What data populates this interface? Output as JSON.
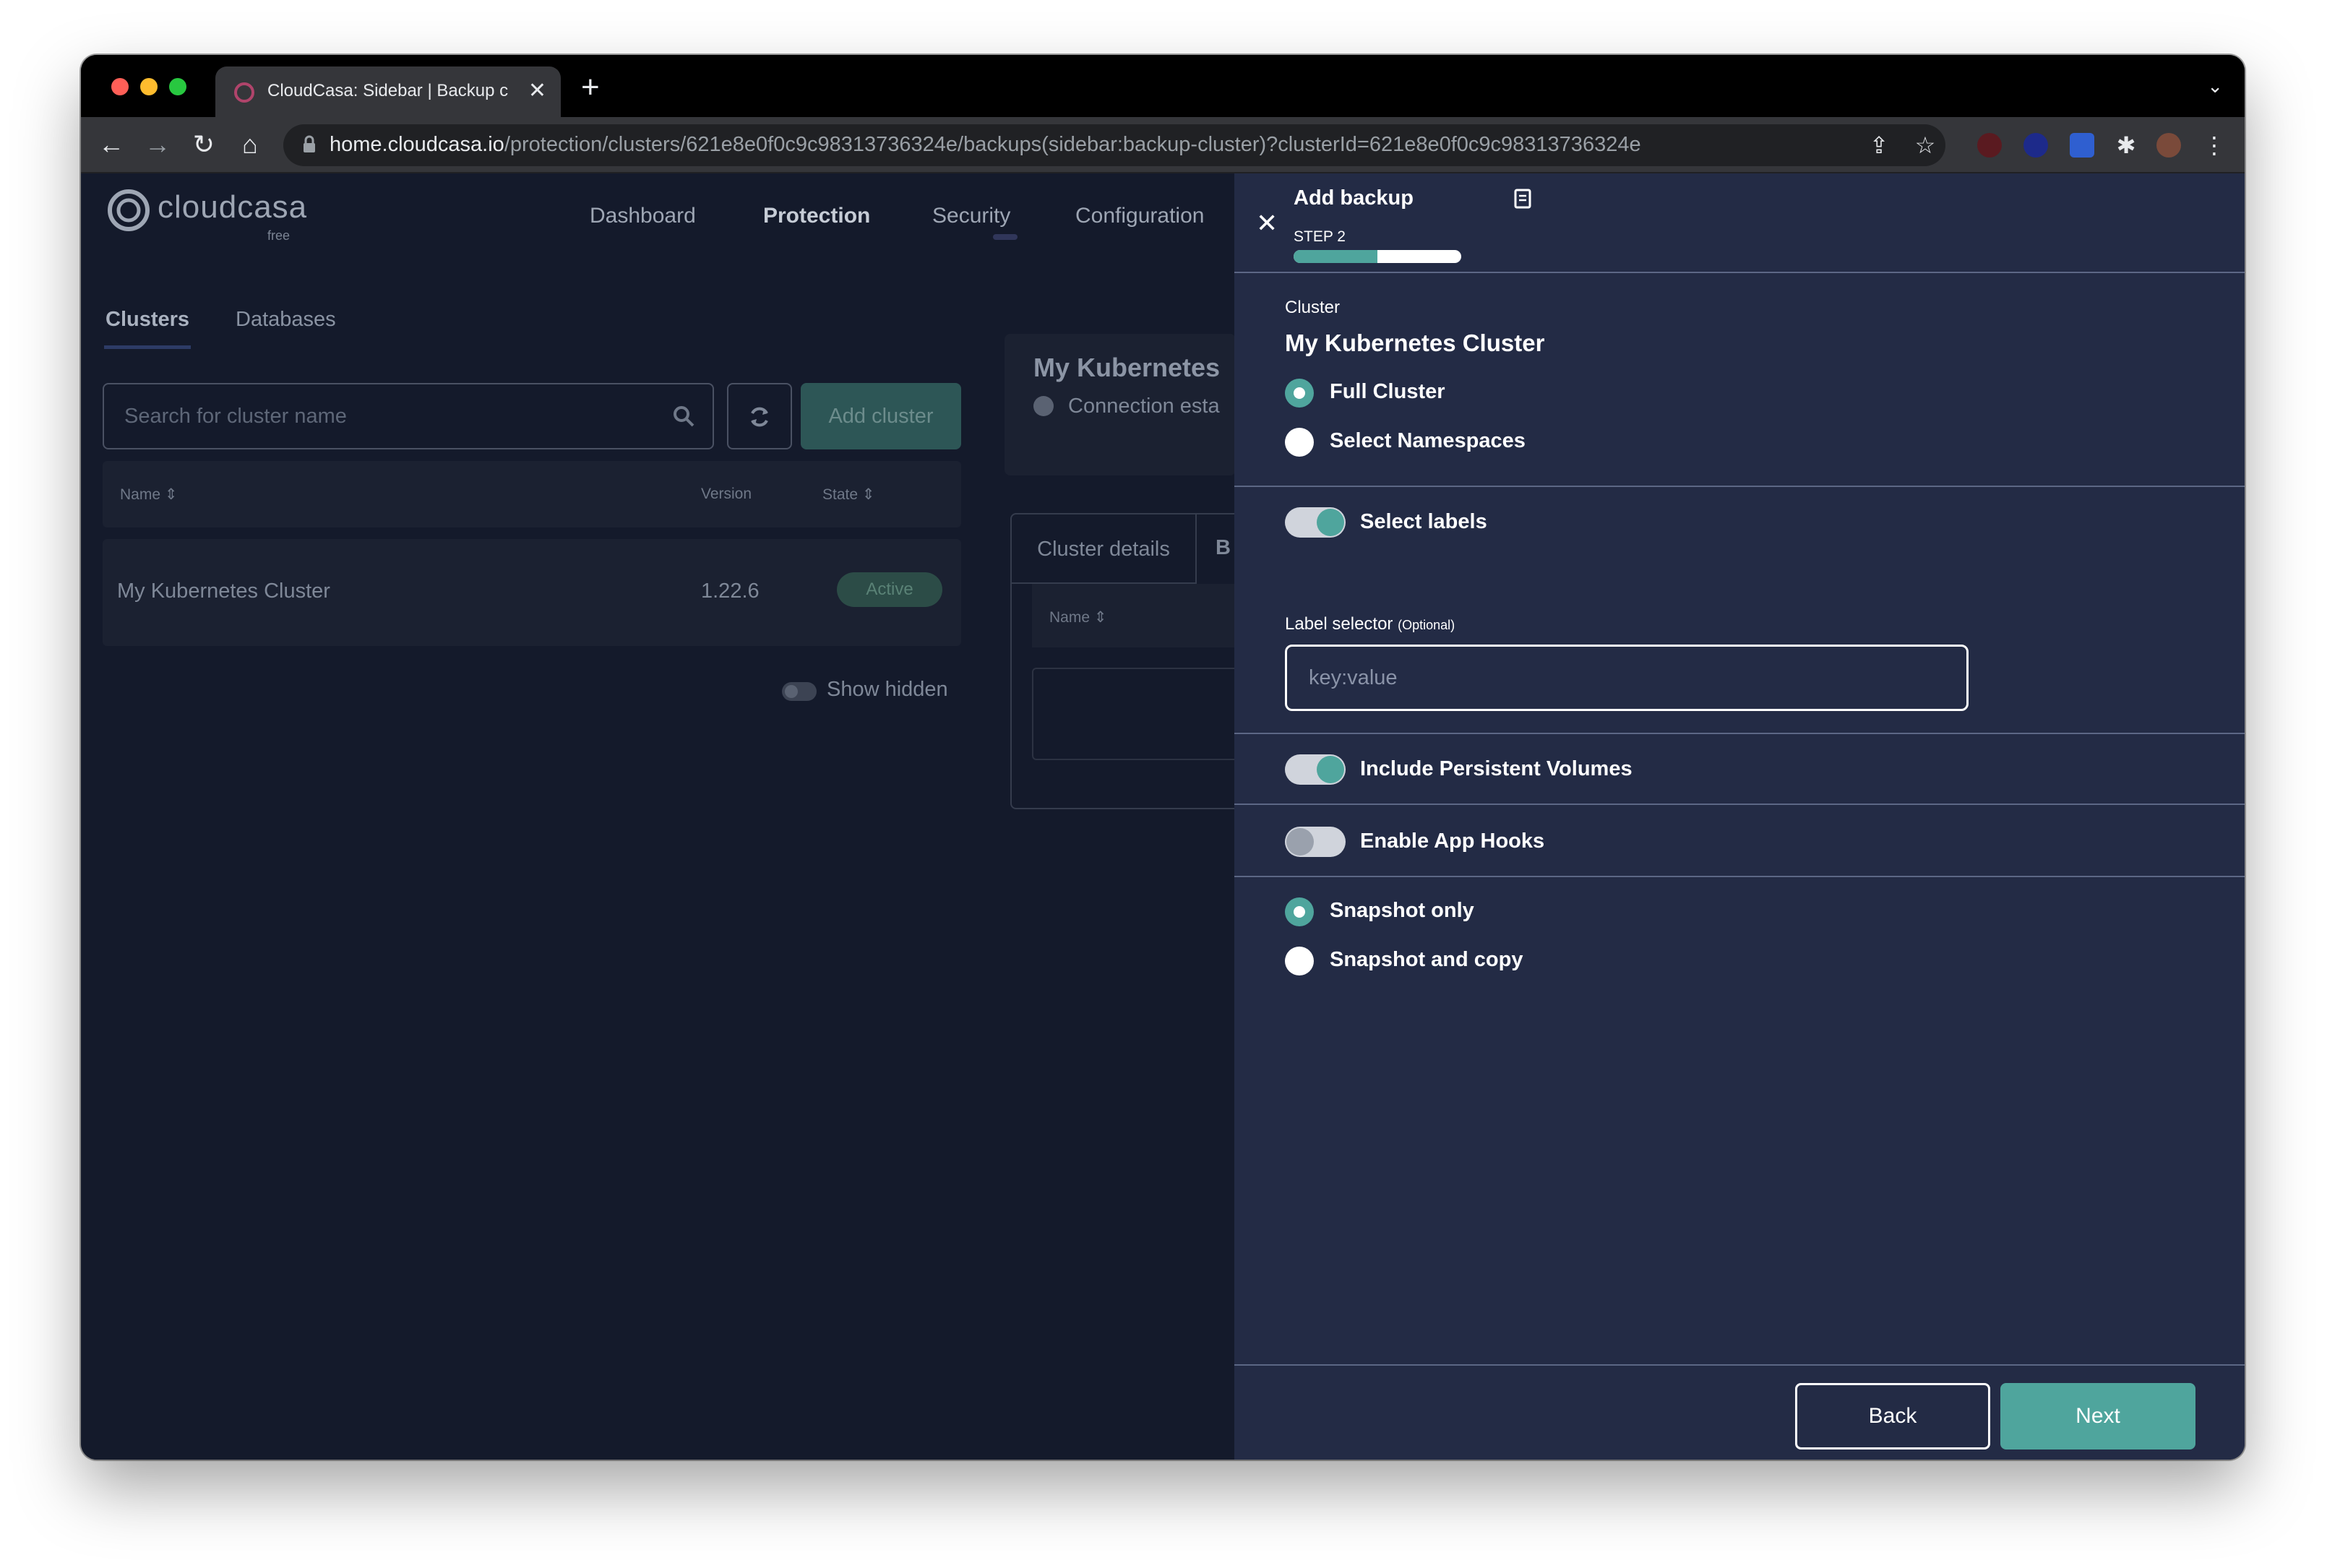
{
  "browser": {
    "tab_title": "CloudCasa: Sidebar | Backup c",
    "url_host": "home.cloudcasa.io",
    "url_path": "/protection/clusters/621e8e0f0c9c98313736324e/backups(sidebar:backup-cluster)?clusterId=621e8e0f0c9c98313736324e"
  },
  "app": {
    "logo": "cloudcasa",
    "logo_sub": "free",
    "nav": [
      "Dashboard",
      "Protection",
      "Security",
      "Configuration"
    ],
    "left_tabs": [
      "Clusters",
      "Databases"
    ],
    "search_placeholder": "Search for cluster name",
    "add_cluster": "Add cluster",
    "table_headers": {
      "name": "Name",
      "version": "Version",
      "state": "State"
    },
    "rows": [
      {
        "name": "My Kubernetes Cluster",
        "version": "1.22.6",
        "state": "Active"
      }
    ],
    "show_hidden": "Show hidden",
    "detail_title": "My Kubernetes",
    "detail_connection": "Connection esta",
    "detail_tab_active": "Cluster details",
    "detail_tab_next": "B",
    "detail_table_name": "Name"
  },
  "panel": {
    "title": "Add backup",
    "step": "STEP 2",
    "progress": 0.5,
    "cluster_label": "Cluster",
    "cluster_name": "My Kubernetes Cluster",
    "scope_options": [
      {
        "label": "Full Cluster",
        "selected": true
      },
      {
        "label": "Select Namespaces",
        "selected": false
      }
    ],
    "select_labels": {
      "label": "Select labels",
      "on": true
    },
    "label_selector_label": "Label selector",
    "label_selector_optional": "(Optional)",
    "label_selector_placeholder": "key:value",
    "include_pv": {
      "label": "Include Persistent Volumes",
      "on": true
    },
    "app_hooks": {
      "label": "Enable App Hooks",
      "on": false
    },
    "snapshot_options": [
      {
        "label": "Snapshot only",
        "selected": true
      },
      {
        "label": "Snapshot and copy",
        "selected": false
      }
    ],
    "back": "Back",
    "next": "Next",
    "accent": "#4fa59d",
    "panel_bg": "#232b45"
  }
}
